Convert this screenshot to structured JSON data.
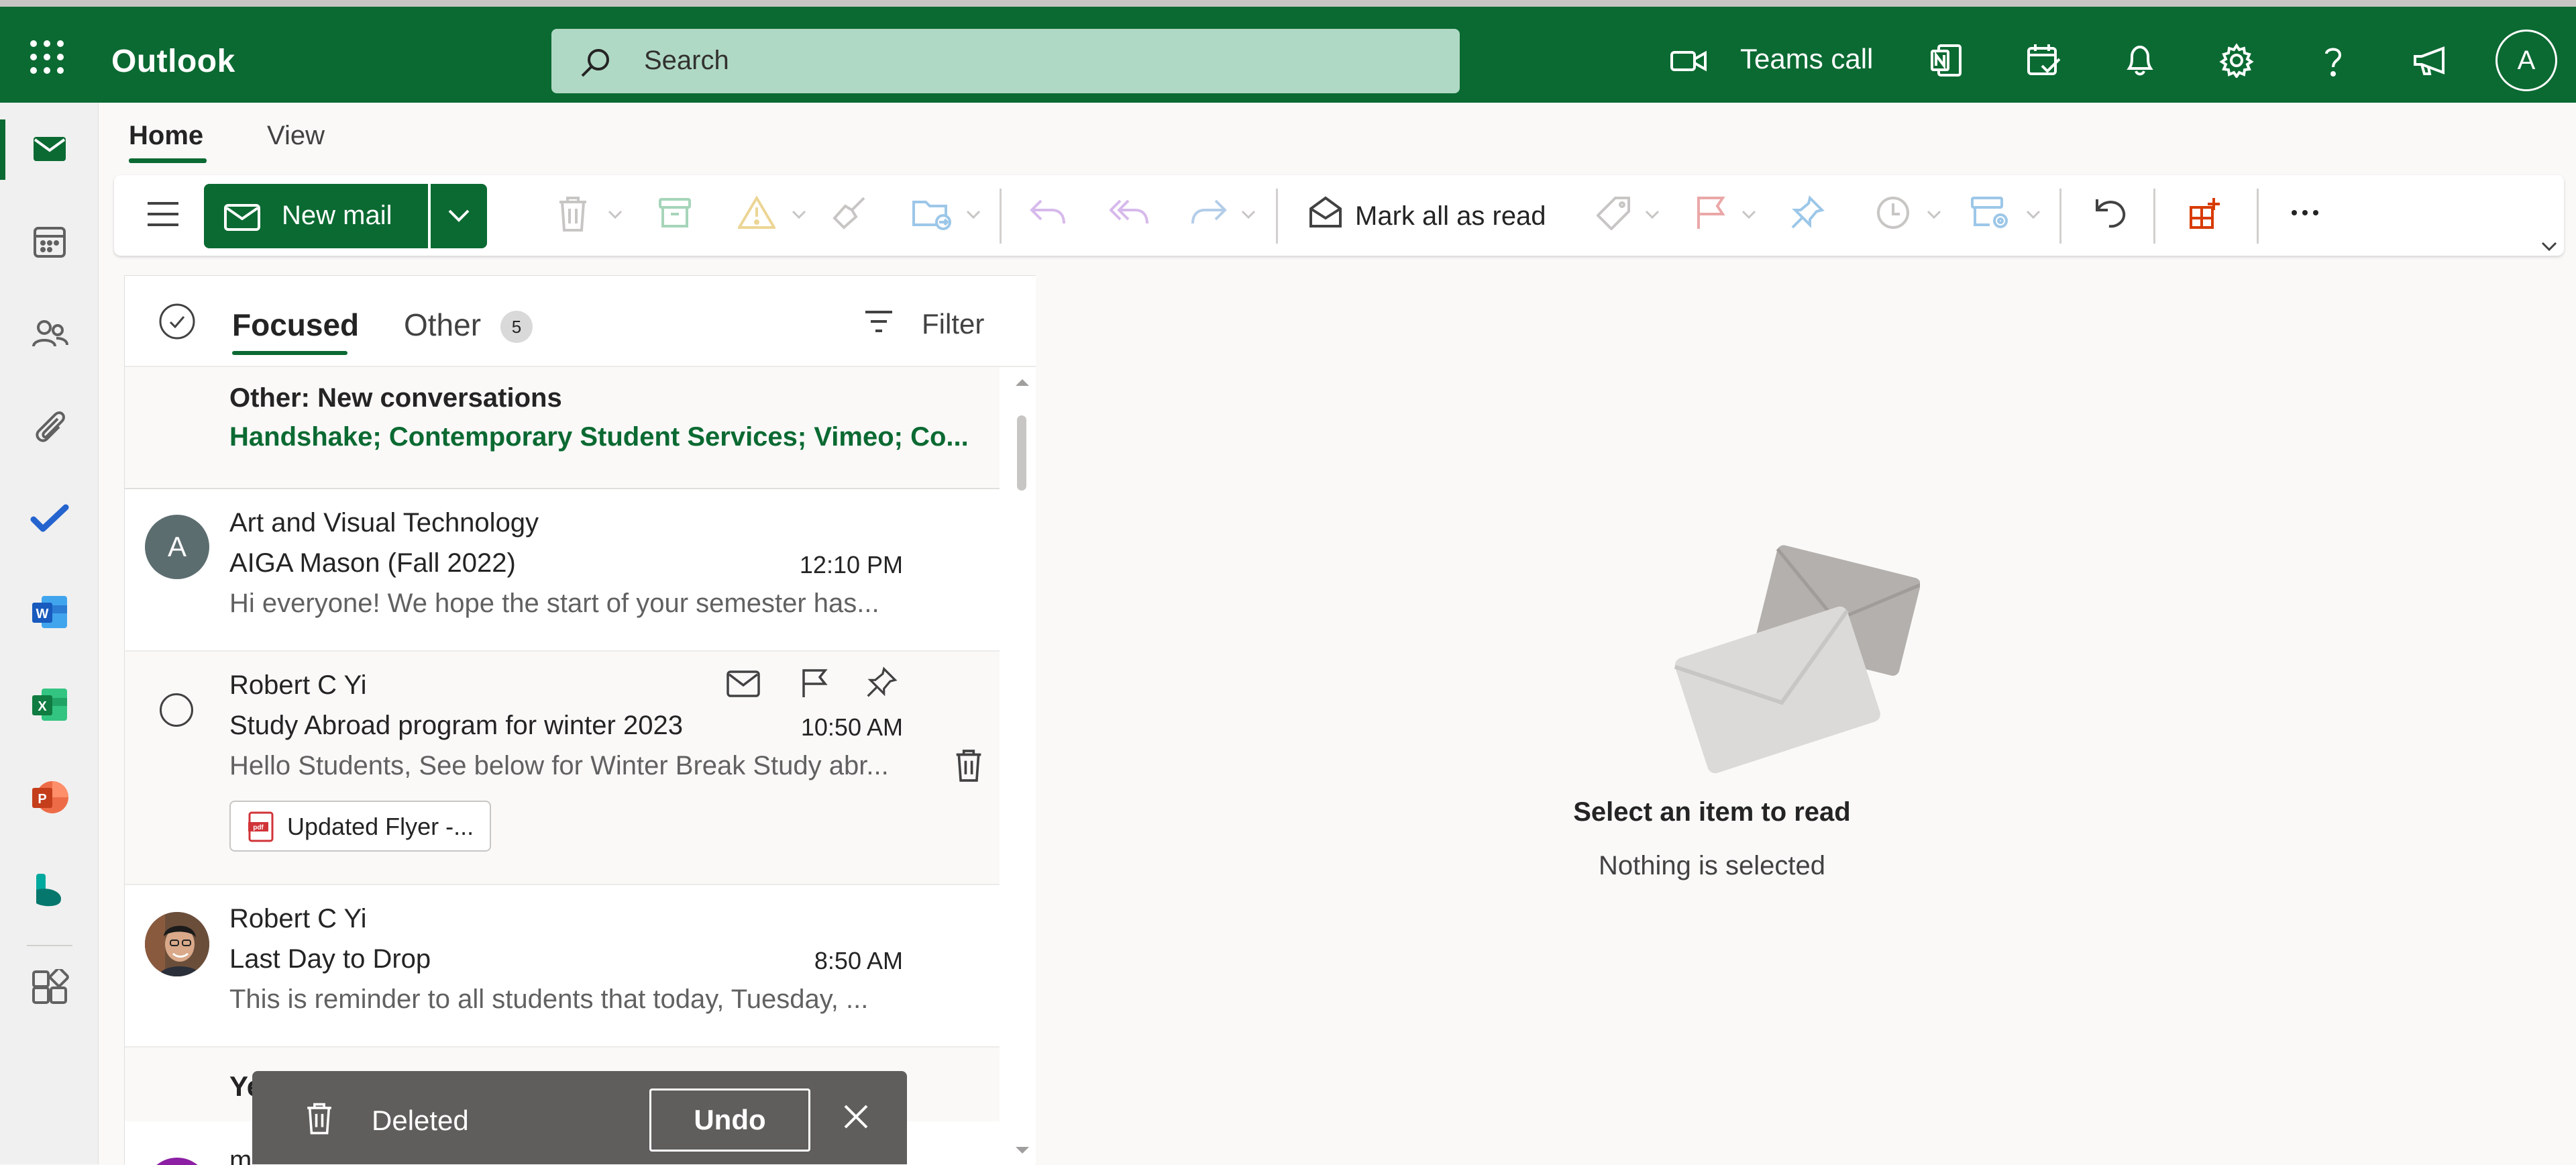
{
  "app": {
    "title": "Outlook"
  },
  "search": {
    "placeholder": "Search"
  },
  "topbar": {
    "teams_call": "Teams call",
    "avatar_initial": "A"
  },
  "ribbon": {
    "tabs": [
      "Home",
      "View"
    ],
    "new_mail": "New mail",
    "mark_all_read": "Mark all as read"
  },
  "list": {
    "tab_focused": "Focused",
    "tab_other": "Other",
    "other_count": "5",
    "filter": "Filter",
    "new_conversations": {
      "title": "Other: New conversations",
      "senders": "Handshake; Contemporary Student Services; Vimeo; Co..."
    },
    "messages": [
      {
        "avatar_initial": "A",
        "sender": "Art and Visual Technology",
        "subject": "AIGA Mason (Fall 2022)",
        "time": "12:10 PM",
        "preview": "Hi everyone! We hope the start of your semester has..."
      },
      {
        "sender": "Robert C Yi",
        "subject": "Study Abroad program for winter 2023",
        "time": "10:50 AM",
        "preview": "Hello Students, See below for Winter Break Study abr...",
        "attachment": "Updated Flyer -..."
      },
      {
        "sender": "Robert C Yi",
        "subject": "Last Day to Drop",
        "time": "8:50 AM",
        "preview": "This is reminder to all students that today, Tuesday, ..."
      }
    ],
    "group_partial": "Ye",
    "partial_sender": "m"
  },
  "toast": {
    "text": "Deleted",
    "undo": "Undo"
  },
  "reading_pane": {
    "title": "Select an item to read",
    "subtitle": "Nothing is selected"
  },
  "colors": {
    "brand": "#0b6a32",
    "search_bg": "#b0d9c5",
    "toast_bg": "#605e5c"
  }
}
